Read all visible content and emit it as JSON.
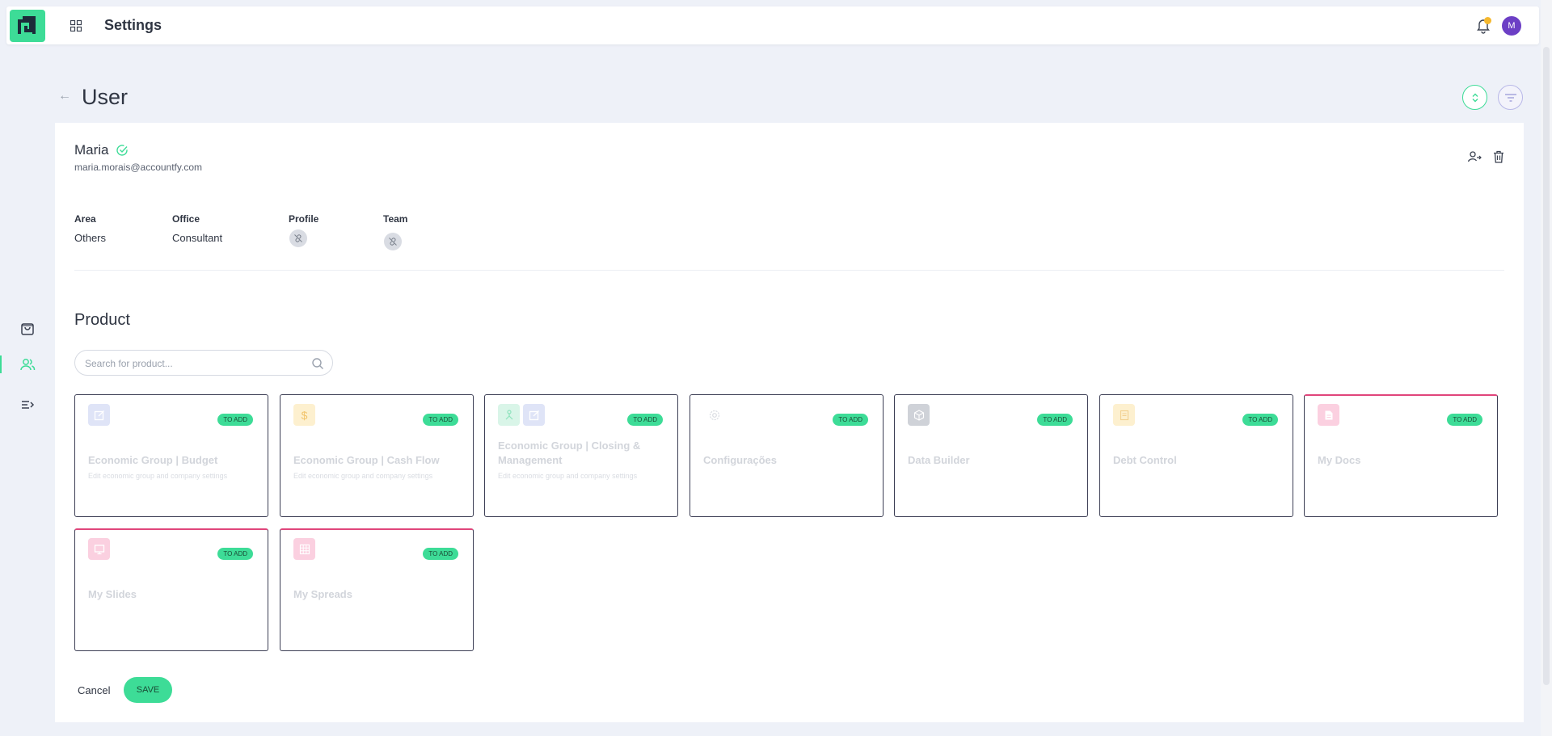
{
  "header": {
    "title": "Settings",
    "avatar_initial": "M",
    "accent_color": "#3ddc97",
    "notification_dot_color": "#f5b82e"
  },
  "sidebar": {
    "items": [
      {
        "icon": "bag-icon"
      },
      {
        "icon": "users-icon",
        "active": true
      },
      {
        "icon": "list-collapse-icon"
      }
    ]
  },
  "page": {
    "title": "User"
  },
  "user": {
    "name": "Maria",
    "email": "maria.morais@accountfy.com",
    "fields": {
      "area_label": "Area",
      "area_value": "Others",
      "office_label": "Office",
      "office_value": "Consultant",
      "profile_label": "Profile",
      "team_label": "Team"
    }
  },
  "product": {
    "section_title": "Product",
    "search_placeholder": "Search for product...",
    "badge_label": "TO ADD",
    "items": [
      {
        "name": "Economic Group | Budget",
        "description": "Edit economic group and company settings",
        "icon": "edit-icon"
      },
      {
        "name": "Economic Group | Cash Flow",
        "description": "Edit economic group and company settings",
        "icon": "dollar-icon"
      },
      {
        "name": "Economic Group | Closing & Management",
        "description": "Edit economic group and company settings",
        "icon": "hierarchy-icon"
      },
      {
        "name": "Configurações",
        "description": "",
        "icon": "gear-icon"
      },
      {
        "name": "Data Builder",
        "description": "",
        "icon": "cube-icon"
      },
      {
        "name": "Debt Control",
        "description": "",
        "icon": "receipt-icon"
      },
      {
        "name": "My Docs",
        "description": "",
        "icon": "doc-icon"
      },
      {
        "name": "My Slides",
        "description": "",
        "icon": "slides-icon"
      },
      {
        "name": "My Spreads",
        "description": "",
        "icon": "grid-icon"
      }
    ]
  },
  "actions": {
    "cancel_label": "Cancel",
    "save_label": "SAVE"
  }
}
